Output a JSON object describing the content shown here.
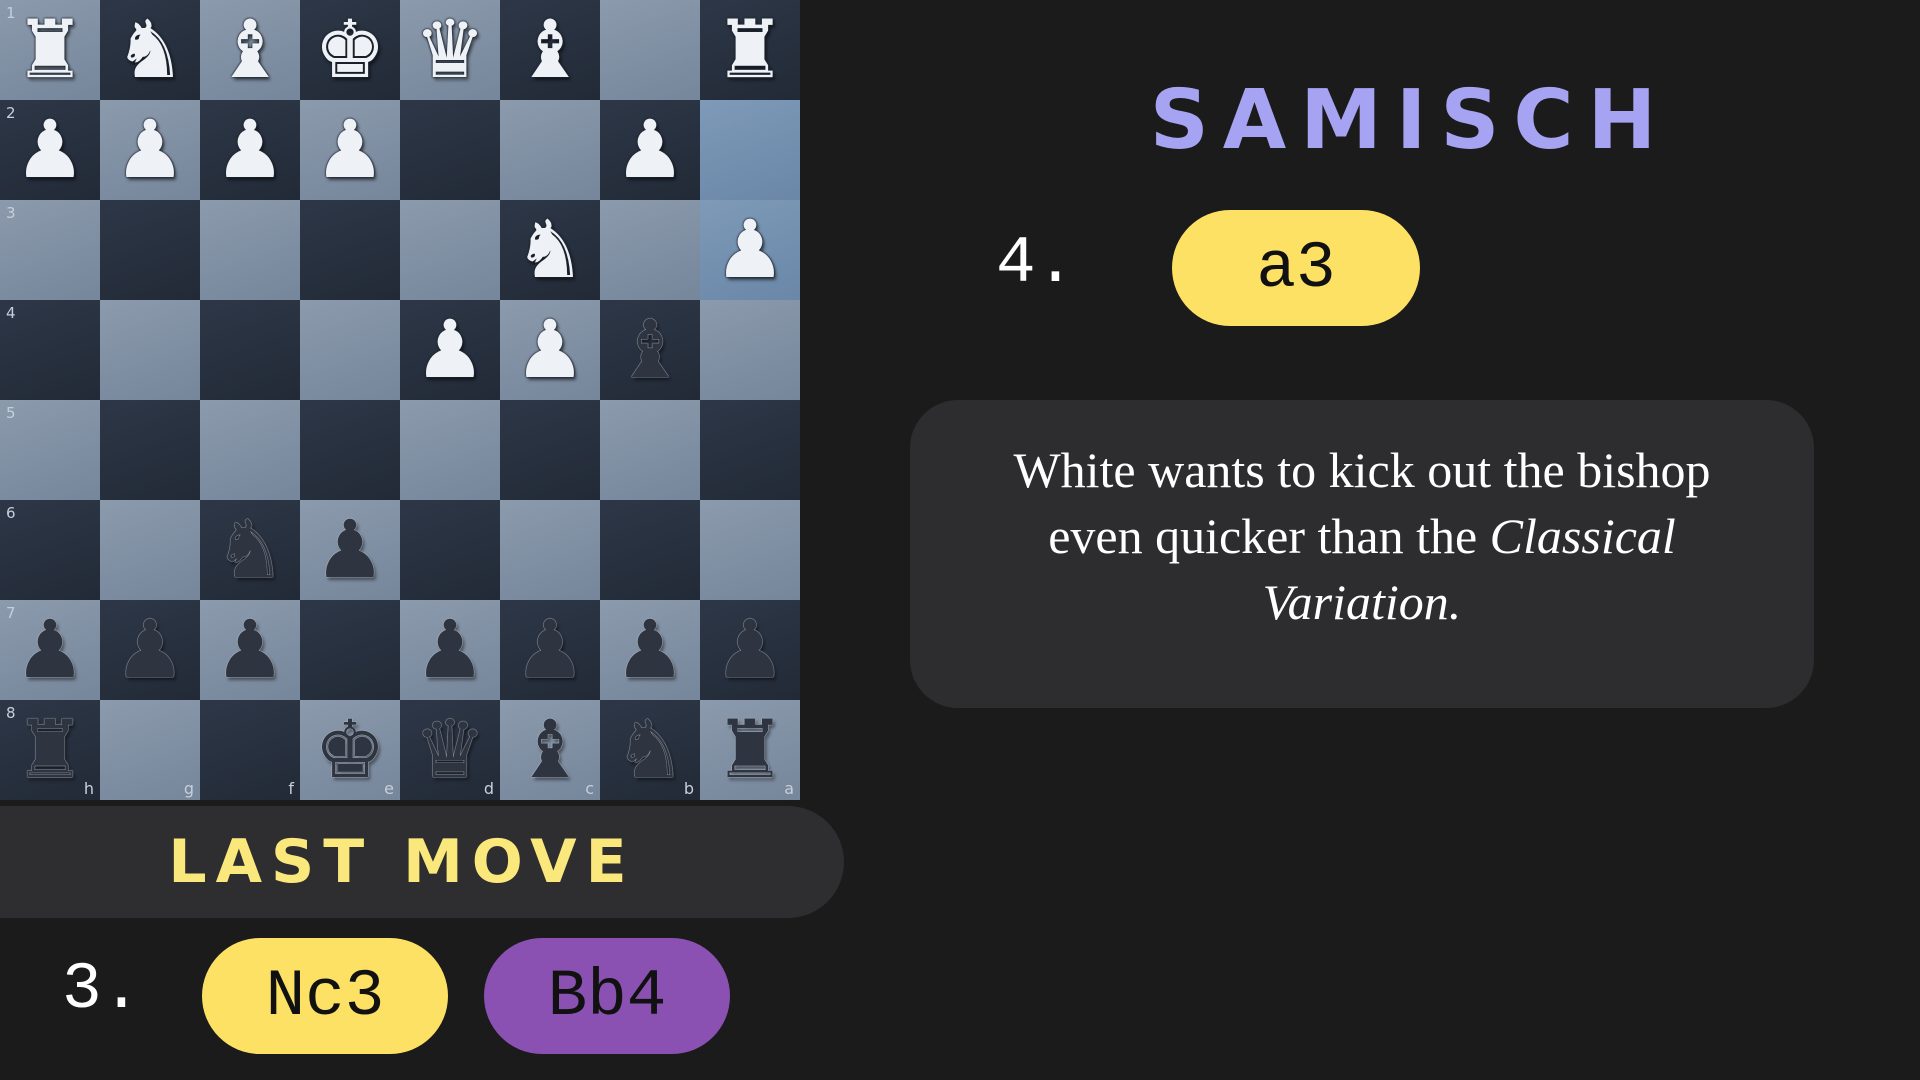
{
  "board": {
    "ranks": [
      "1",
      "2",
      "3",
      "4",
      "5",
      "6",
      "7",
      "8"
    ],
    "files_bottom": [
      "h",
      "g",
      "f",
      "e",
      "d",
      "c",
      "b",
      "a"
    ],
    "highlight_squares": [
      [
        1,
        7
      ],
      [
        2,
        7
      ]
    ],
    "rows": [
      [
        {
          "c": "w",
          "p": "♜",
          "n": "white-rook"
        },
        {
          "c": "w",
          "p": "♞",
          "n": "white-knight"
        },
        {
          "c": "w",
          "p": "♝",
          "n": "white-bishop"
        },
        {
          "c": "w",
          "p": "♚",
          "n": "white-king"
        },
        {
          "c": "w",
          "p": "♛",
          "n": "white-queen"
        },
        {
          "c": "w",
          "p": "♝",
          "n": "white-bishop"
        },
        null,
        {
          "c": "w",
          "p": "♜",
          "n": "white-rook"
        }
      ],
      [
        {
          "c": "w",
          "p": "♟",
          "n": "white-pawn"
        },
        {
          "c": "w",
          "p": "♟",
          "n": "white-pawn"
        },
        {
          "c": "w",
          "p": "♟",
          "n": "white-pawn"
        },
        {
          "c": "w",
          "p": "♟",
          "n": "white-pawn"
        },
        null,
        null,
        {
          "c": "w",
          "p": "♟",
          "n": "white-pawn"
        },
        null
      ],
      [
        null,
        null,
        null,
        null,
        null,
        {
          "c": "w",
          "p": "♞",
          "n": "white-knight"
        },
        null,
        {
          "c": "w",
          "p": "♟",
          "n": "white-pawn"
        }
      ],
      [
        null,
        null,
        null,
        null,
        {
          "c": "w",
          "p": "♟",
          "n": "white-pawn"
        },
        {
          "c": "w",
          "p": "♟",
          "n": "white-pawn"
        },
        {
          "c": "b",
          "p": "♝",
          "n": "black-bishop"
        },
        null
      ],
      [
        null,
        null,
        null,
        null,
        null,
        null,
        null,
        null
      ],
      [
        null,
        null,
        {
          "c": "b",
          "p": "♞",
          "n": "black-knight"
        },
        {
          "c": "b",
          "p": "♟",
          "n": "black-pawn"
        },
        null,
        null,
        null,
        null
      ],
      [
        {
          "c": "b",
          "p": "♟",
          "n": "black-pawn"
        },
        {
          "c": "b",
          "p": "♟",
          "n": "black-pawn"
        },
        {
          "c": "b",
          "p": "♟",
          "n": "black-pawn"
        },
        null,
        {
          "c": "b",
          "p": "♟",
          "n": "black-pawn"
        },
        {
          "c": "b",
          "p": "♟",
          "n": "black-pawn"
        },
        {
          "c": "b",
          "p": "♟",
          "n": "black-pawn"
        },
        {
          "c": "b",
          "p": "♟",
          "n": "black-pawn"
        }
      ],
      [
        {
          "c": "b",
          "p": "♜",
          "n": "black-rook"
        },
        null,
        null,
        {
          "c": "b",
          "p": "♚",
          "n": "black-king"
        },
        {
          "c": "b",
          "p": "♛",
          "n": "black-queen"
        },
        {
          "c": "b",
          "p": "♝",
          "n": "black-bishop"
        },
        {
          "c": "b",
          "p": "♞",
          "n": "black-knight"
        },
        {
          "c": "b",
          "p": "♜",
          "n": "black-rook"
        }
      ]
    ]
  },
  "last_move": {
    "title": "LAST MOVE",
    "number": "3.",
    "white": "Nc3",
    "black": "Bb4"
  },
  "variation": {
    "title": "SAMISCH",
    "number": "4.",
    "move": "a3",
    "description_plain": "White wants to kick out the bishop even quicker than the ",
    "description_italic": "Classical Variation."
  },
  "colors": {
    "yellow": "#fde165",
    "purple": "#8a51b2",
    "title_lavender": "#a6a4f2",
    "last_move_title": "#fbe87c"
  }
}
